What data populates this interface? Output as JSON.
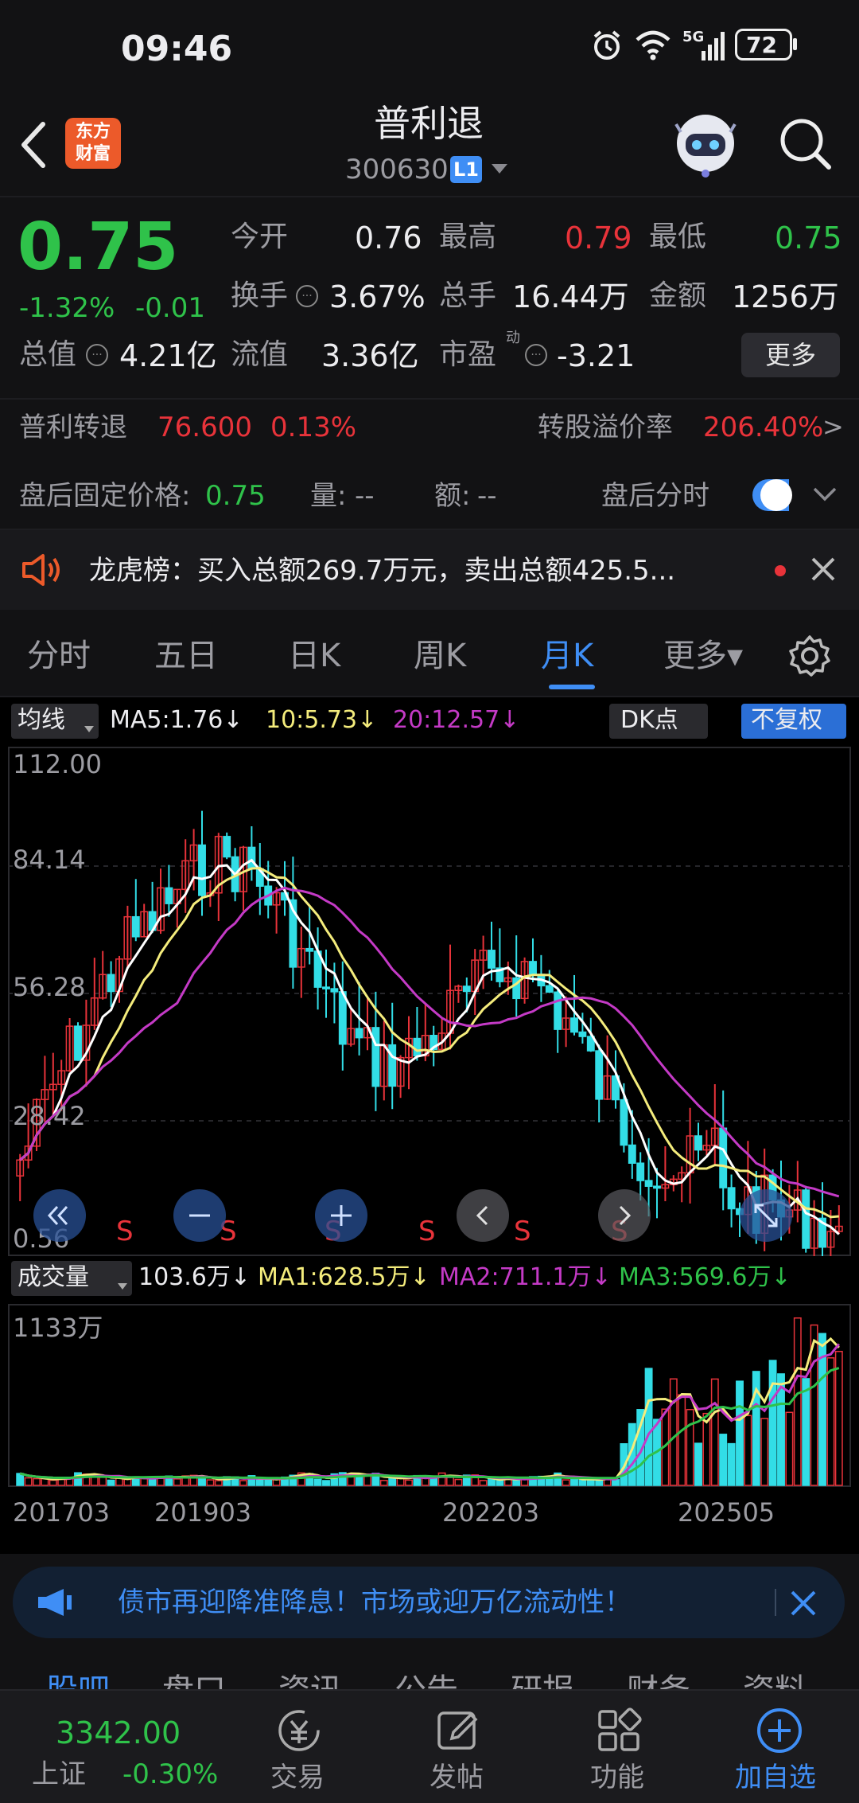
{
  "status_bar": {
    "time": "09:46",
    "battery": "72",
    "network": "5G"
  },
  "header": {
    "title": "普利退",
    "code": "300630",
    "badge": "L1",
    "logo_line1": "东方",
    "logo_line2": "财富"
  },
  "quote": {
    "price": "0.75",
    "change_pct": "-1.32%",
    "change": "-0.01",
    "open_label": "今开",
    "open": "0.76",
    "high_label": "最高",
    "high": "0.79",
    "low_label": "最低",
    "low": "0.75",
    "turnover_label": "换手",
    "turnover": "3.67%",
    "volume_label": "总手",
    "volume": "16.44万",
    "amount_label": "金额",
    "amount": "1256万",
    "mktcap_label": "总值",
    "mktcap": "4.21亿",
    "float_label": "流值",
    "float": "3.36亿",
    "pe_label": "市盈",
    "pe_sup": "动",
    "pe": "-3.21",
    "more_button": "更多"
  },
  "convertible": {
    "name": "普利转退",
    "price": "76.600",
    "pct": "0.13%",
    "premium_label": "转股溢价率",
    "premium": "206.40%",
    "arrow": ">"
  },
  "after_hours": {
    "label": "盘后固定价格:",
    "price": "0.75",
    "vol_label": "量:",
    "vol": "--",
    "amt_label": "额:",
    "amt": "--",
    "toggle_label": "盘后分时",
    "toggle_on": true
  },
  "notice": {
    "text": "龙虎榜：买入总额269.7万元，卖出总额425.5..."
  },
  "tabs": {
    "items": [
      "分时",
      "五日",
      "日K",
      "周K",
      "月K",
      "更多▾"
    ],
    "active": 4
  },
  "ma_bar": {
    "selector": "均线",
    "ma5": "MA5:1.76↓",
    "ma10": "10:5.73↓",
    "ma20": "20:12.57↓",
    "dk": "DK点",
    "adjust": "不复权"
  },
  "chart_axis": {
    "y_ticks": [
      "112.00",
      "84.14",
      "56.28",
      "28.42",
      "0.56"
    ],
    "sell_marker": "S"
  },
  "volume_bar": {
    "selector": "成交量",
    "vol": "103.6万↓",
    "ma1": "MA1:628.5万↓",
    "ma2": "MA2:711.1万↓",
    "ma3": "MA3:569.6万↓",
    "max": "1133万"
  },
  "x_ticks": [
    "201703",
    "201903",
    "202203",
    "202505"
  ],
  "banner": {
    "text": "债市再迎降准降息！市场或迎万亿流动性！"
  },
  "sub_tabs": [
    "股吧",
    "盘口",
    "资讯",
    "公告",
    "研报",
    "财务",
    "资料"
  ],
  "bottom_nav": {
    "index_value": "3342.00",
    "index_name": "上证",
    "index_change": "-0.30%",
    "items": [
      "交易",
      "发帖",
      "功能",
      "加自选"
    ]
  },
  "colors": {
    "up": "#e8333a",
    "down": "#2fc24a",
    "accent": "#3f8ef5",
    "ma5": "#ffffff",
    "ma10": "#f4ec7c",
    "ma20": "#c43ac6",
    "hollow": "#32dde6"
  },
  "chart_data": {
    "type": "candlestick",
    "y_range": [
      0.56,
      112.0
    ],
    "x_ticks": [
      "201703",
      "201903",
      "202203",
      "202505"
    ],
    "ma_last": {
      "MA5": 1.76,
      "MA10": 5.73,
      "MA20": 12.57
    },
    "volume_range": [
      0,
      1133
    ],
    "volume_unit": "万",
    "volume_last": 103.6,
    "volume_ma_last": {
      "MA1": 628.5,
      "MA2": 711.1,
      "MA3": 569.6
    }
  }
}
